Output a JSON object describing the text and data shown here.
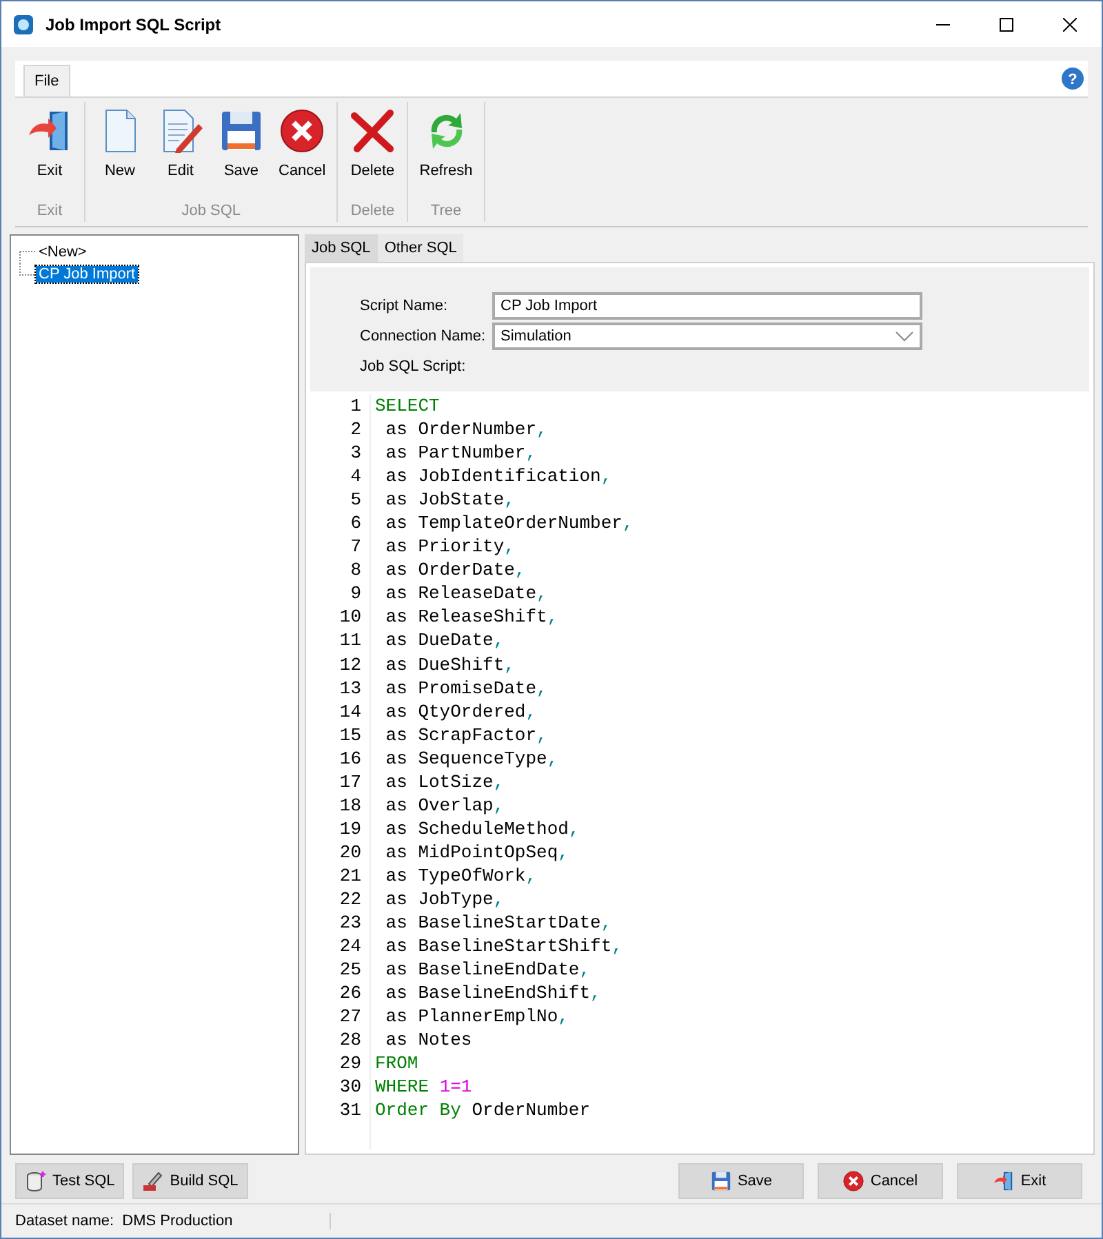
{
  "window": {
    "title": "Job Import SQL Script"
  },
  "ribbon": {
    "tabs": [
      {
        "label": "File",
        "selected": true
      }
    ],
    "help_glyph": "?",
    "groups": [
      {
        "label": "Exit",
        "buttons": [
          {
            "label": "Exit",
            "kind": "exit"
          }
        ]
      },
      {
        "label": "Job SQL",
        "buttons": [
          {
            "label": "New",
            "kind": "new"
          },
          {
            "label": "Edit",
            "kind": "edit"
          },
          {
            "label": "Save",
            "kind": "save"
          },
          {
            "label": "Cancel",
            "kind": "cancel"
          }
        ]
      },
      {
        "label": "Delete",
        "buttons": [
          {
            "label": "Delete",
            "kind": "delete"
          }
        ]
      },
      {
        "label": "Tree",
        "buttons": [
          {
            "label": "Refresh",
            "kind": "refresh"
          }
        ]
      }
    ]
  },
  "tree": {
    "items": [
      {
        "label": "<New>",
        "selected": false
      },
      {
        "label": "CP Job Import",
        "selected": true
      }
    ]
  },
  "editor_tabs": [
    {
      "label": "Job SQL",
      "selected": true
    },
    {
      "label": "Other SQL",
      "selected": false
    }
  ],
  "form": {
    "script_name": {
      "label": "Script Name:",
      "value": "CP Job Import"
    },
    "connection_name": {
      "label": "Connection Name:",
      "value": "Simulation"
    },
    "script_label": "Job SQL Script:"
  },
  "code": [
    {
      "n": "1",
      "tokens": [
        {
          "t": "SELECT",
          "kind": "keyword"
        }
      ]
    },
    {
      "n": "2",
      "tokens": [
        {
          "t": " as OrderNumber",
          "kind": "text"
        },
        {
          "t": ",",
          "kind": "punct"
        }
      ]
    },
    {
      "n": "3",
      "tokens": [
        {
          "t": " as PartNumber",
          "kind": "text"
        },
        {
          "t": ",",
          "kind": "punct"
        }
      ]
    },
    {
      "n": "4",
      "tokens": [
        {
          "t": " as JobIdentification",
          "kind": "text"
        },
        {
          "t": ",",
          "kind": "punct"
        }
      ]
    },
    {
      "n": "5",
      "tokens": [
        {
          "t": " as JobState",
          "kind": "text"
        },
        {
          "t": ",",
          "kind": "punct"
        }
      ]
    },
    {
      "n": "6",
      "tokens": [
        {
          "t": " as TemplateOrderNumber",
          "kind": "text"
        },
        {
          "t": ",",
          "kind": "punct"
        }
      ]
    },
    {
      "n": "7",
      "tokens": [
        {
          "t": " as Priority",
          "kind": "text"
        },
        {
          "t": ",",
          "kind": "punct"
        }
      ]
    },
    {
      "n": "8",
      "tokens": [
        {
          "t": " as OrderDate",
          "kind": "text"
        },
        {
          "t": ",",
          "kind": "punct"
        }
      ]
    },
    {
      "n": "9",
      "tokens": [
        {
          "t": " as ReleaseDate",
          "kind": "text"
        },
        {
          "t": ",",
          "kind": "punct"
        }
      ]
    },
    {
      "n": "10",
      "tokens": [
        {
          "t": " as ReleaseShift",
          "kind": "text"
        },
        {
          "t": ",",
          "kind": "punct"
        }
      ]
    },
    {
      "n": "11",
      "tokens": [
        {
          "t": " as DueDate",
          "kind": "text"
        },
        {
          "t": ",",
          "kind": "punct"
        }
      ]
    },
    {
      "n": "12",
      "tokens": [
        {
          "t": " as DueShift",
          "kind": "text"
        },
        {
          "t": ",",
          "kind": "punct"
        }
      ]
    },
    {
      "n": "13",
      "tokens": [
        {
          "t": " as PromiseDate",
          "kind": "text"
        },
        {
          "t": ",",
          "kind": "punct"
        }
      ]
    },
    {
      "n": "14",
      "tokens": [
        {
          "t": " as QtyOrdered",
          "kind": "text"
        },
        {
          "t": ",",
          "kind": "punct"
        }
      ]
    },
    {
      "n": "15",
      "tokens": [
        {
          "t": " as ScrapFactor",
          "kind": "text"
        },
        {
          "t": ",",
          "kind": "punct"
        }
      ]
    },
    {
      "n": "16",
      "tokens": [
        {
          "t": " as SequenceType",
          "kind": "text"
        },
        {
          "t": ",",
          "kind": "punct"
        }
      ]
    },
    {
      "n": "17",
      "tokens": [
        {
          "t": " as LotSize",
          "kind": "text"
        },
        {
          "t": ",",
          "kind": "punct"
        }
      ]
    },
    {
      "n": "18",
      "tokens": [
        {
          "t": " as Overlap",
          "kind": "text"
        },
        {
          "t": ",",
          "kind": "punct"
        }
      ]
    },
    {
      "n": "19",
      "tokens": [
        {
          "t": " as ScheduleMethod",
          "kind": "text"
        },
        {
          "t": ",",
          "kind": "punct"
        }
      ]
    },
    {
      "n": "20",
      "tokens": [
        {
          "t": " as MidPointOpSeq",
          "kind": "text"
        },
        {
          "t": ",",
          "kind": "punct"
        }
      ]
    },
    {
      "n": "21",
      "tokens": [
        {
          "t": " as TypeOfWork",
          "kind": "text"
        },
        {
          "t": ",",
          "kind": "punct"
        }
      ]
    },
    {
      "n": "22",
      "tokens": [
        {
          "t": " as JobType",
          "kind": "text"
        },
        {
          "t": ",",
          "kind": "punct"
        }
      ]
    },
    {
      "n": "23",
      "tokens": [
        {
          "t": " as BaselineStartDate",
          "kind": "text"
        },
        {
          "t": ",",
          "kind": "punct"
        }
      ]
    },
    {
      "n": "24",
      "tokens": [
        {
          "t": " as BaselineStartShift",
          "kind": "text"
        },
        {
          "t": ",",
          "kind": "punct"
        }
      ]
    },
    {
      "n": "25",
      "tokens": [
        {
          "t": " as BaselineEndDate",
          "kind": "text"
        },
        {
          "t": ",",
          "kind": "punct"
        }
      ]
    },
    {
      "n": "26",
      "tokens": [
        {
          "t": " as BaselineEndShift",
          "kind": "text"
        },
        {
          "t": ",",
          "kind": "punct"
        }
      ]
    },
    {
      "n": "27",
      "tokens": [
        {
          "t": " as PlannerEmplNo",
          "kind": "text"
        },
        {
          "t": ",",
          "kind": "punct"
        }
      ]
    },
    {
      "n": "28",
      "tokens": [
        {
          "t": " as Notes",
          "kind": "text"
        }
      ]
    },
    {
      "n": "29",
      "tokens": [
        {
          "t": "FROM",
          "kind": "keyword"
        }
      ]
    },
    {
      "n": "30",
      "tokens": [
        {
          "t": "WHERE",
          "kind": "keyword"
        },
        {
          "t": " 1=1",
          "kind": "number"
        }
      ]
    },
    {
      "n": "31",
      "tokens": [
        {
          "t": "Order By",
          "kind": "keyword"
        },
        {
          "t": " OrderNumber",
          "kind": "text"
        }
      ]
    }
  ],
  "bottom_left_buttons": [
    {
      "label": "Test SQL",
      "kind": "test"
    },
    {
      "label": "Build SQL",
      "kind": "build"
    }
  ],
  "bottom_right_buttons": [
    {
      "label": "Save",
      "kind": "save"
    },
    {
      "label": "Cancel",
      "kind": "cancel"
    },
    {
      "label": "Exit",
      "kind": "exit"
    }
  ],
  "status_bar": {
    "label": "Dataset name:",
    "value": "DMS Production"
  }
}
